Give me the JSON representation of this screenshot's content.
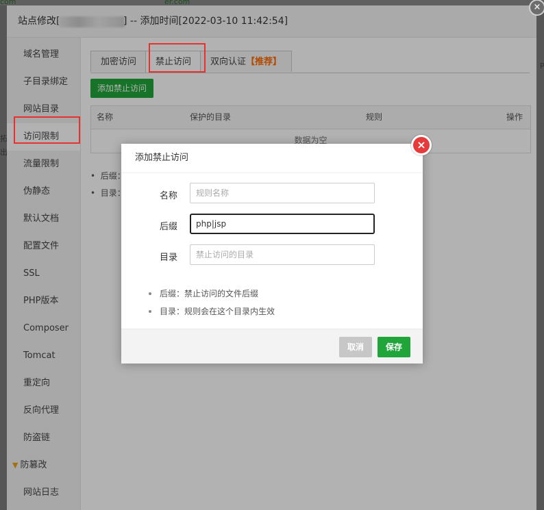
{
  "background": {
    "fragments": [
      "com",
      "er.com"
    ],
    "left_fragments": [
      "拓",
      "出"
    ],
    "right_fragment": "P"
  },
  "outer_dialog": {
    "title_lead": "站点修改[",
    "title_trail": "] -- 添加时间[2022-03-10 11:42:54]",
    "close_glyph": "×"
  },
  "sidebar": {
    "items": [
      {
        "label": "域名管理"
      },
      {
        "label": "子目录绑定"
      },
      {
        "label": "网站目录"
      },
      {
        "label": "访问限制"
      },
      {
        "label": "流量限制"
      },
      {
        "label": "伪静态"
      },
      {
        "label": "默认文档"
      },
      {
        "label": "配置文件"
      },
      {
        "label": "SSL"
      },
      {
        "label": "PHP版本"
      },
      {
        "label": "Composer"
      },
      {
        "label": "Tomcat"
      },
      {
        "label": "重定向"
      },
      {
        "label": "反向代理"
      },
      {
        "label": "防盗链"
      },
      {
        "label": "防篡改",
        "icon": "diamond-icon"
      },
      {
        "label": "网站日志"
      }
    ],
    "active_index": 3
  },
  "tabs": [
    {
      "label": "加密访问"
    },
    {
      "label": "禁止访问"
    },
    {
      "label": "双向认证",
      "badge": "【推荐】"
    }
  ],
  "add_button": "添加禁止访问",
  "table": {
    "headers": [
      "名称",
      "保护的目录",
      "规则",
      "操作"
    ],
    "empty_text": "数据为空"
  },
  "notes": [
    "后缀：",
    "目录："
  ],
  "modal": {
    "title": "添加禁止访问",
    "fields": {
      "name": {
        "label": "名称",
        "placeholder": "规则名称",
        "value": ""
      },
      "suffix": {
        "label": "后缀",
        "placeholder": "",
        "value": "php|jsp"
      },
      "dir": {
        "label": "目录",
        "placeholder": "禁止访问的目录",
        "value": ""
      }
    },
    "tips": [
      "后缀：禁止访问的文件后缀",
      "目录：规则会在这个目录内生效"
    ],
    "cancel": "取消",
    "save": "保存",
    "close_glyph": "×"
  },
  "colors": {
    "primary_green": "#20a53a",
    "highlight_red": "#e8312f",
    "recommend_orange": "#ff6a00",
    "close_red": "#e73a3a"
  }
}
